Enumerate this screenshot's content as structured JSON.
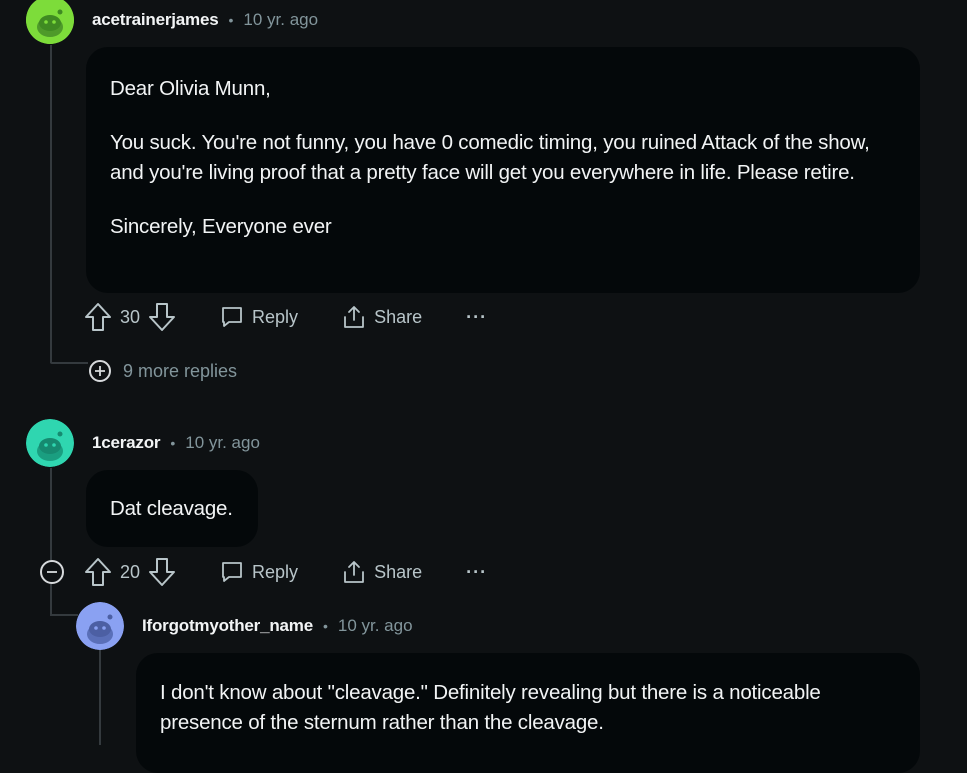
{
  "comments": [
    {
      "username": "acetrainerjames",
      "time": "10 yr. ago",
      "paragraphs": [
        "Dear Olivia Munn,",
        "You suck. You're not funny, you have 0 comedic timing, you ruined Attack of the show, and you're living proof that a pretty face will get you everywhere in life. Please retire.",
        "Sincerely, Everyone ever"
      ],
      "score": "30",
      "reply_label": "Reply",
      "share_label": "Share",
      "more_replies": "9 more replies",
      "avatar_color": "#7ddc3a"
    },
    {
      "username": "1cerazor",
      "time": "10 yr. ago",
      "paragraphs": [
        "Dat cleavage."
      ],
      "score": "20",
      "reply_label": "Reply",
      "share_label": "Share",
      "avatar_color": "#2fd6b0"
    },
    {
      "username": "Iforgotmyother_name",
      "time": "10 yr. ago",
      "paragraphs": [
        "I don't know about \"cleavage.\" Definitely revealing but there is a noticeable presence of the sternum rather than the cleavage."
      ],
      "avatar_color": "#8aa1f2"
    }
  ],
  "separator": "•",
  "more_actions": "···"
}
